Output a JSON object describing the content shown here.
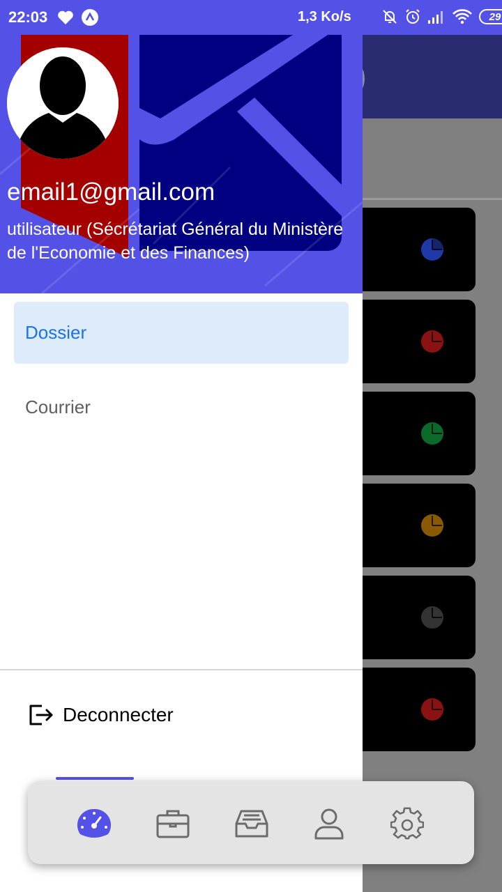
{
  "status_bar": {
    "time": "22:03",
    "network_speed": "1,3 Ko/s",
    "battery_level": "29",
    "icons": [
      "heart-icon",
      "app-notification-icon",
      "bell-off-icon",
      "alarm-icon",
      "signal-icon",
      "wifi-icon",
      "battery-icon"
    ]
  },
  "background_screen": {
    "title_fragment": "r)",
    "card_pie_colors": [
      "#1f3aa8",
      "#8b1212",
      "#0b6a2a",
      "#8a5a00",
      "#333333",
      "#8b1212"
    ]
  },
  "drawer": {
    "user": {
      "email": "email1@gmail.com",
      "role": "utilisateur (Sécrétariat Général du Ministère de l'Economie et des Finances)"
    },
    "menu": [
      {
        "label": "Dossier",
        "active": true
      },
      {
        "label": "Courrier",
        "active": false
      }
    ],
    "logout_label": "Deconnecter"
  },
  "bottom_nav": {
    "items": [
      {
        "icon": "dashboard-gauge-icon",
        "active": true
      },
      {
        "icon": "briefcase-icon",
        "active": false
      },
      {
        "icon": "inbox-tray-icon",
        "active": false
      },
      {
        "icon": "user-profile-icon",
        "active": false
      },
      {
        "icon": "settings-gear-icon",
        "active": false
      }
    ]
  },
  "colors": {
    "primary": "#5451e6",
    "active_menu_bg": "#deebfb",
    "active_menu_text": "#1a73e8"
  }
}
